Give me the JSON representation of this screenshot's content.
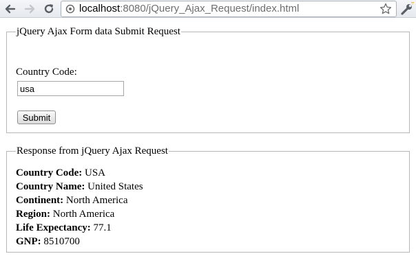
{
  "browser": {
    "url_host": "localhost",
    "url_path": ":8080/jQuery_Ajax_Request/index.html",
    "icons": [
      "back-icon",
      "forward-icon",
      "reload-icon",
      "page-icon",
      "star-icon",
      "wrench-icon"
    ]
  },
  "form_section": {
    "legend": "jQuery Ajax Form data Submit Request",
    "country_code_label": "Country Code:",
    "country_code_value": "usa",
    "submit_label": "Submit"
  },
  "response_section": {
    "legend": "Response from jQuery Ajax Request",
    "rows": [
      {
        "label": "Country Code:",
        "value": "USA"
      },
      {
        "label": "Country Name:",
        "value": "United States"
      },
      {
        "label": "Continent:",
        "value": "North America"
      },
      {
        "label": "Region:",
        "value": "North America"
      },
      {
        "label": "Life Expectancy:",
        "value": "77.1"
      },
      {
        "label": "GNP:",
        "value": "8510700"
      }
    ]
  }
}
